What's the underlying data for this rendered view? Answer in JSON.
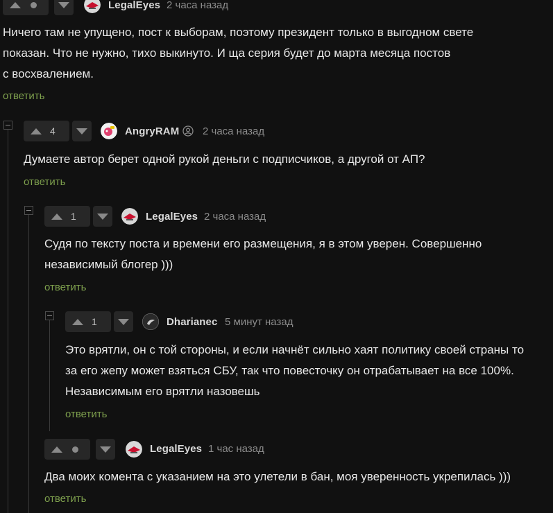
{
  "comments": [
    {
      "id": "c1",
      "author": "LegalEyes",
      "time": "2 часа назад",
      "rating": "",
      "text_lines": [
        "Ничего там не упущено, пост к выборам, поэтому президент только в выгодном свете",
        "показан. Что не нужно, тихо выкинуто. И ща серия будет до марта месяца постов",
        "с восхвалением."
      ],
      "reply_label": "ответить"
    },
    {
      "id": "c2",
      "author": "AngryRAM",
      "time": "2 часа назад",
      "rating": "4",
      "text_lines": [
        "Думаете автор берет одной рукой деньги с подписчиков, а другой от АП?"
      ],
      "reply_label": "ответить"
    },
    {
      "id": "c3",
      "author": "LegalEyes",
      "time": "2 часа назад",
      "rating": "1",
      "text_lines": [
        "Судя по тексту поста и времени его размещения, я в этом уверен. Совершенно",
        "независимый блогер )))"
      ],
      "reply_label": "ответить"
    },
    {
      "id": "c4",
      "author": "Dharianec",
      "time": "5 минут назад",
      "rating": "1",
      "text_lines": [
        "Это врятли, он с той стороны, и если начнёт сильно хаят политику своей страны то",
        "за его жепу может взяться СБУ, так что повесточку он отрабатывает на все 100%.",
        "Независимым его врятли назовешь"
      ],
      "reply_label": "ответить"
    },
    {
      "id": "c5",
      "author": "LegalEyes",
      "time": "1 час назад",
      "rating": "",
      "text_lines": [
        "Два моих комента с указанием на это улетели в бан, моя уверенность укрепилась )))"
      ],
      "reply_label": "ответить"
    }
  ],
  "colors": {
    "background": "#111111",
    "reply_link": "#7ea04d",
    "muted": "#8c8c8c"
  },
  "icons": {
    "upvote": "triangle-up",
    "downvote": "triangle-down",
    "no_rating": "dot",
    "collapse": "minus-box",
    "verified": "user-circle-icon"
  }
}
